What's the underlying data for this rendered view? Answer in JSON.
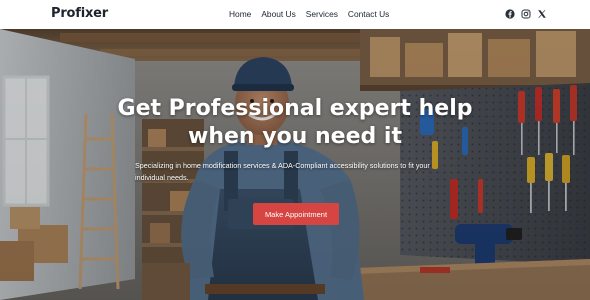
{
  "brand": {
    "name": "Profixer",
    "accent": "#d64541",
    "text": "#1d2430"
  },
  "nav": {
    "items": [
      {
        "label": "Home"
      },
      {
        "label": "About Us"
      },
      {
        "label": "Services"
      },
      {
        "label": "Contact Us"
      }
    ]
  },
  "socials": [
    {
      "icon": "facebook-icon"
    },
    {
      "icon": "instagram-icon"
    },
    {
      "icon": "x-twitter-icon"
    }
  ],
  "hero": {
    "title_line1": "Get Professional expert help",
    "title_line2": "when you need it",
    "subtitle_line1": "Specializing in home modification services & ADA-Compliant accessibility solutions to fit your",
    "subtitle_line2": "individual needs.",
    "cta_label": "Make Appointment"
  }
}
